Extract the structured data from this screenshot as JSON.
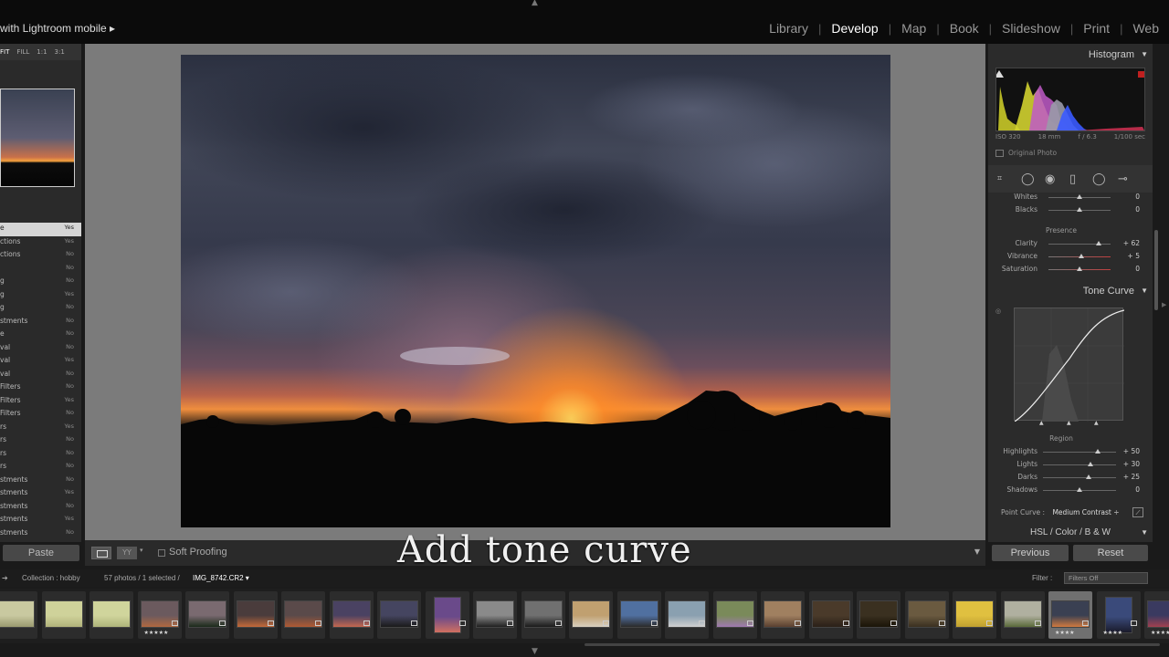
{
  "app": {
    "identity_text": "with Lightroom mobile  ▸",
    "modules": [
      {
        "label": "Library",
        "active": false
      },
      {
        "label": "Develop",
        "active": true
      },
      {
        "label": "Map",
        "active": false
      },
      {
        "label": "Book",
        "active": false
      },
      {
        "label": "Slideshow",
        "active": false
      },
      {
        "label": "Print",
        "active": false
      },
      {
        "label": "Web",
        "active": false
      }
    ]
  },
  "left_panel": {
    "zoom_options": [
      "FIT",
      "FILL",
      "1:1",
      "3:1"
    ],
    "rows": [
      {
        "label": "e",
        "value": "Yes",
        "highlight": true
      },
      {
        "label": "ctions",
        "value": "Yes"
      },
      {
        "label": "ctions",
        "value": "No"
      },
      {
        "label": "",
        "value": "No"
      },
      {
        "label": "g",
        "value": "No"
      },
      {
        "label": "g",
        "value": "Yes"
      },
      {
        "label": "g",
        "value": "No"
      },
      {
        "label": "stments",
        "value": "No"
      },
      {
        "label": "e",
        "value": "No"
      },
      {
        "label": "val",
        "value": "No"
      },
      {
        "label": "val",
        "value": "Yes"
      },
      {
        "label": "val",
        "value": "No"
      },
      {
        "label": "Filters",
        "value": "No"
      },
      {
        "label": "Filters",
        "value": "Yes"
      },
      {
        "label": "Filters",
        "value": "No"
      },
      {
        "label": "rs",
        "value": "Yes"
      },
      {
        "label": "rs",
        "value": "No"
      },
      {
        "label": "rs",
        "value": "No"
      },
      {
        "label": "rs",
        "value": "No"
      },
      {
        "label": "stments",
        "value": "No"
      },
      {
        "label": "stments",
        "value": "Yes"
      },
      {
        "label": "stments",
        "value": "No"
      },
      {
        "label": "stments",
        "value": "Yes"
      },
      {
        "label": "stments",
        "value": "No"
      }
    ],
    "paste_label": "Paste"
  },
  "toolbar": {
    "compare_label": "YY",
    "soft_proofing_label": "Soft Proofing",
    "caption": "Add tone curve"
  },
  "right_panel": {
    "histogram_title": "Histogram",
    "histogram_info": [
      "ISO 320",
      "18 mm",
      "f / 6.3",
      "1/100 sec"
    ],
    "original_photo_label": "Original Photo",
    "basic_rows": [
      {
        "label": "Whites",
        "value": "0",
        "pos": 0.5
      },
      {
        "label": "Blacks",
        "value": "0",
        "pos": 0.5
      }
    ],
    "presence_label": "Presence",
    "presence_rows": [
      {
        "label": "Clarity",
        "value": "+ 62",
        "pos": 0.81
      },
      {
        "label": "Vibrance",
        "value": "+ 5",
        "pos": 0.53
      },
      {
        "label": "Saturation",
        "value": "0",
        "pos": 0.5
      }
    ],
    "tone_curve_title": "Tone Curve",
    "region_label": "Region",
    "region_rows": [
      {
        "label": "Highlights",
        "value": "+ 50",
        "pos": 0.75
      },
      {
        "label": "Lights",
        "value": "+ 30",
        "pos": 0.65
      },
      {
        "label": "Darks",
        "value": "+ 25",
        "pos": 0.625
      },
      {
        "label": "Shadows",
        "value": "0",
        "pos": 0.5
      }
    ],
    "point_curve_label": "Point Curve :",
    "point_curve_value": "Medium Contrast ÷",
    "hsl_tabs": "HSL  /  Color  /  B & W",
    "previous_label": "Previous",
    "reset_label": "Reset"
  },
  "filmstrip": {
    "collection": "Collection : hobby",
    "count": "57 photos / 1 selected /",
    "filename": "IMG_8742.CR2  ▾",
    "filter_label": "Filter :",
    "filter_value": "Filters Off",
    "thumbs": [
      {
        "colors": [
          "#c9c9a0",
          "#9a9a70"
        ],
        "stars": "",
        "sel": false
      },
      {
        "colors": [
          "#cfd29a",
          "#b0b27a"
        ],
        "stars": "",
        "sel": false
      },
      {
        "colors": [
          "#d0d59c",
          "#aeb47a"
        ],
        "stars": "",
        "sel": false
      },
      {
        "colors": [
          "#6b5a5e",
          "#b06840"
        ],
        "stars": "★★★★★",
        "sel": false
      },
      {
        "colors": [
          "#7a6a70",
          "#1a2a1a"
        ],
        "stars": "",
        "sel": false
      },
      {
        "colors": [
          "#4a3c3c",
          "#c46a3a"
        ],
        "stars": "",
        "sel": false
      },
      {
        "colors": [
          "#5a4a4a",
          "#b05a34"
        ],
        "stars": "",
        "sel": false
      },
      {
        "colors": [
          "#4a4262",
          "#c46850"
        ],
        "stars": "",
        "sel": false
      },
      {
        "colors": [
          "#454560",
          "#1a1a1a"
        ],
        "stars": "",
        "sel": false
      },
      {
        "colors": [
          "#6a4a8a",
          "#d27060"
        ],
        "stars": "",
        "sel": false,
        "tall": true
      },
      {
        "colors": [
          "#8a8a8a",
          "#202020"
        ],
        "stars": "",
        "sel": false
      },
      {
        "colors": [
          "#707070",
          "#1a1a1a"
        ],
        "stars": "",
        "sel": false
      },
      {
        "colors": [
          "#c0a070",
          "#d8d0c0"
        ],
        "stars": "",
        "sel": false
      },
      {
        "colors": [
          "#5070a0",
          "#2a2a2a"
        ],
        "stars": "",
        "sel": false
      },
      {
        "colors": [
          "#8aa0b0",
          "#d0d0d0"
        ],
        "stars": "",
        "sel": false
      },
      {
        "colors": [
          "#7a8a5a",
          "#a07ab0"
        ],
        "stars": "",
        "sel": false
      },
      {
        "colors": [
          "#a08060",
          "#5a4030"
        ],
        "stars": "",
        "sel": false
      },
      {
        "colors": [
          "#4a3a2a",
          "#2a2018"
        ],
        "stars": "",
        "sel": false
      },
      {
        "colors": [
          "#3a3020",
          "#1a1408"
        ],
        "stars": "",
        "sel": false
      },
      {
        "colors": [
          "#6a5a40",
          "#3a3020"
        ],
        "stars": "",
        "sel": false
      },
      {
        "colors": [
          "#e0c040",
          "#c0a030"
        ],
        "stars": "",
        "sel": false
      },
      {
        "colors": [
          "#b0b0a0",
          "#5a6a3a"
        ],
        "stars": "",
        "sel": false
      },
      {
        "colors": [
          "#3a4052",
          "#d07a40"
        ],
        "stars": "★★★★",
        "sel": true
      },
      {
        "colors": [
          "#3a4a7a",
          "#1a1a2a"
        ],
        "stars": "★★★★",
        "sel": false,
        "tall": true
      },
      {
        "colors": [
          "#3a3a60",
          "#a04050"
        ],
        "stars": "★★★★★",
        "sel": false
      }
    ]
  },
  "colors": {
    "panel": "#2b2b2b",
    "canvas": "#7b7b7b",
    "accent": "#ffffff"
  }
}
